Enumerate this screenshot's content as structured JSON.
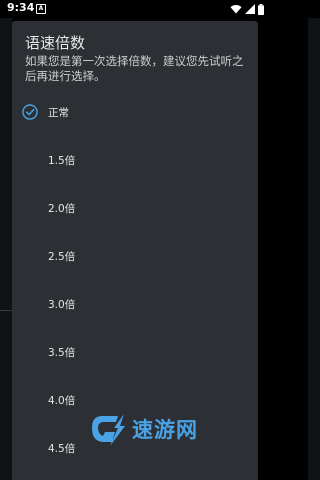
{
  "status_bar": {
    "time": "9:34",
    "notification_glyph": "A"
  },
  "dialog": {
    "title": "语速倍数",
    "message": "如果您是第一次选择倍数，建议您先试听之后再进行选择。",
    "options": [
      {
        "label": "正常",
        "selected": true
      },
      {
        "label": "1.5倍",
        "selected": false
      },
      {
        "label": "2.0倍",
        "selected": false
      },
      {
        "label": "2.5倍",
        "selected": false
      },
      {
        "label": "3.0倍",
        "selected": false
      },
      {
        "label": "3.5倍",
        "selected": false
      },
      {
        "label": "4.0倍",
        "selected": false
      },
      {
        "label": "4.5倍",
        "selected": false
      }
    ]
  },
  "watermark": {
    "text": "速游网"
  },
  "colors": {
    "accent": "#4aa3e6",
    "dialog_bg": "#2c2f33",
    "text": "#e6e6e6"
  },
  "icons": [
    "wifi-icon",
    "signal-icon",
    "battery-icon",
    "check-circle-icon",
    "watermark-logo-icon"
  ]
}
